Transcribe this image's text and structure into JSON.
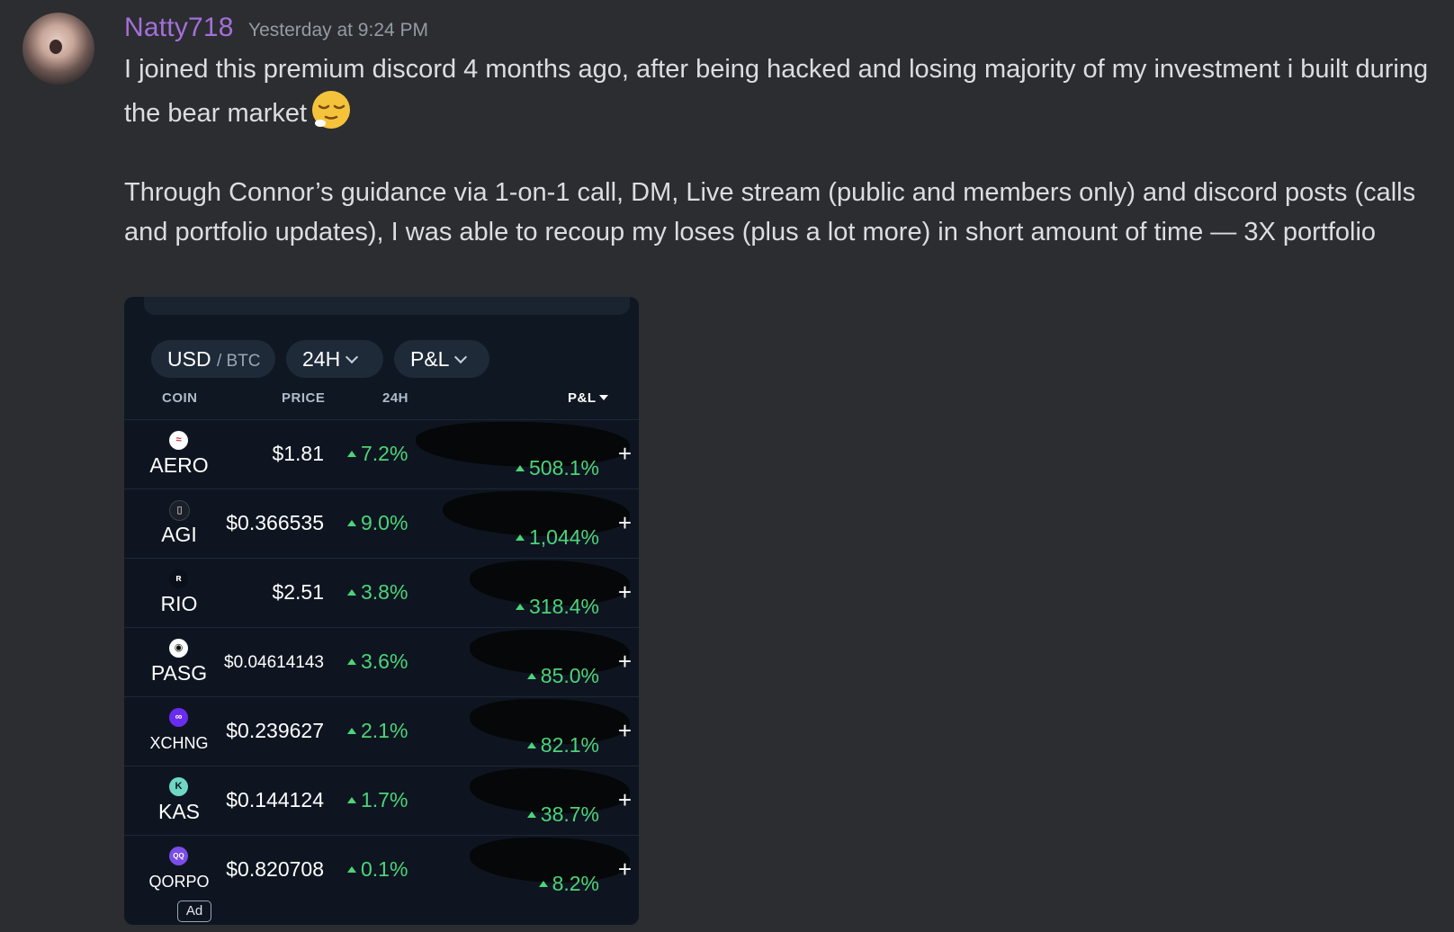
{
  "message": {
    "username": "Natty718",
    "timestamp": "Yesterday at 9:24 PM",
    "paragraph1": "I joined this premium discord 4 months ago, after being hacked and losing majority of my investment i built during the bear market",
    "paragraph2": "Through Connor’s guidance via 1-on-1 call, DM, Live stream (public and members only)  and discord posts (calls and portfolio updates), I was able to recoup my loses (plus a lot more) in short amount of time — 3X portfolio",
    "emoji": "relieved-face-emoji",
    "username_color": "#a56fd8"
  },
  "portfolio": {
    "currency_primary": "USD",
    "currency_secondary": "/ BTC",
    "timeframe": "24H",
    "metric": "P&L",
    "columns": {
      "coin": "COIN",
      "price": "PRICE",
      "change": "24H",
      "pnl": "P&L"
    },
    "rows": [
      {
        "symbol": "AERO",
        "price": "$1.81",
        "change": "7.2%",
        "pnl": "508.1%",
        "icon": "aero-icon"
      },
      {
        "symbol": "AGI",
        "price": "$0.366535",
        "change": "9.0%",
        "pnl": "1,044%",
        "icon": "agi-icon"
      },
      {
        "symbol": "RIO",
        "price": "$2.51",
        "change": "3.8%",
        "pnl": "318.4%",
        "icon": "rio-icon"
      },
      {
        "symbol": "PASG",
        "price": "$0.04614143",
        "change": "3.6%",
        "pnl": "85.0%",
        "icon": "pasg-icon"
      },
      {
        "symbol": "XCHNG",
        "price": "$0.239627",
        "change": "2.1%",
        "pnl": "82.1%",
        "icon": "xchng-icon"
      },
      {
        "symbol": "KAS",
        "price": "$0.144124",
        "change": "1.7%",
        "pnl": "38.7%",
        "icon": "kas-icon"
      },
      {
        "symbol": "QORPO",
        "price": "$0.820708",
        "change": "0.1%",
        "pnl": "8.2%",
        "icon": "qorpo-icon"
      }
    ],
    "ad_label": "Ad",
    "plus_label": "+",
    "positive_color": "#4cd47a"
  }
}
